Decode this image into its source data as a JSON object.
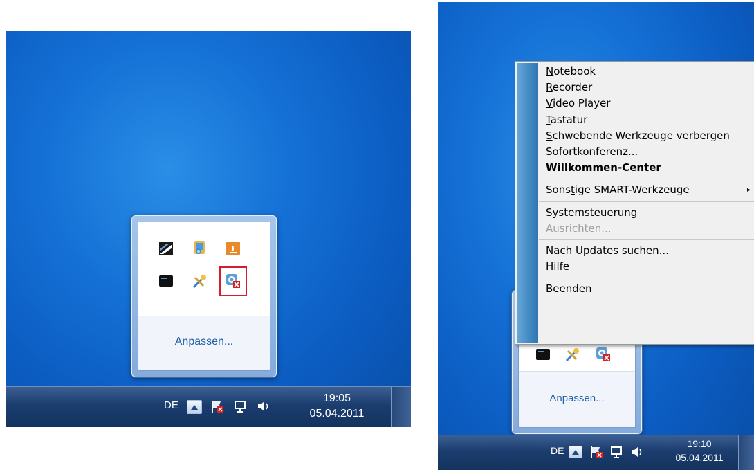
{
  "left": {
    "tray": {
      "language": "DE",
      "time": "19:05",
      "date": "05.04.2011"
    },
    "overflow": {
      "customize_label": "Anpassen...",
      "icons": [
        "smart-board-icon",
        "windows-update-icon",
        "java-update-icon",
        "device-app-icon",
        "tool-icon",
        "smart-tools-disconnected-icon"
      ]
    }
  },
  "right": {
    "tray": {
      "language": "DE",
      "time": "19:10",
      "date": "05.04.2011"
    },
    "overflow": {
      "customize_label": "Anpassen..."
    },
    "menu": {
      "items": [
        {
          "pre": "",
          "acc": "N",
          "post": "otebook"
        },
        {
          "pre": "",
          "acc": "R",
          "post": "ecorder"
        },
        {
          "pre": "",
          "acc": "V",
          "post": "ideo Player"
        },
        {
          "pre": "",
          "acc": "T",
          "post": "astatur"
        },
        {
          "pre": "",
          "acc": "S",
          "post": "chwebende Werkzeuge verbergen"
        },
        {
          "pre": "S",
          "acc": "o",
          "post": "fortkonferenz..."
        },
        {
          "pre": "",
          "acc": "W",
          "post": "illkommen-Center"
        },
        {
          "pre": "Sons",
          "acc": "t",
          "post": "ige SMART-Werkzeuge"
        },
        {
          "pre": "S",
          "acc": "y",
          "post": "stemsteuerung"
        },
        {
          "pre": "",
          "acc": "A",
          "post": "usrichten..."
        },
        {
          "pre": "Nach ",
          "acc": "U",
          "post": "pdates suchen..."
        },
        {
          "pre": "",
          "acc": "H",
          "post": "ilfe"
        },
        {
          "pre": "",
          "acc": "B",
          "post": "eenden"
        }
      ],
      "submenu_arrow": "▸"
    }
  }
}
